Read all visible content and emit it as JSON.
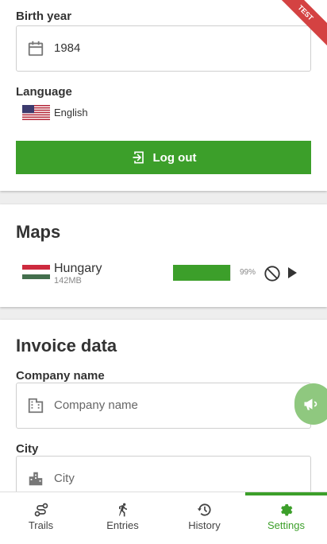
{
  "profile": {
    "birth_year_label": "Birth year",
    "birth_year_value": "1984",
    "language_label": "Language",
    "language_value": "English",
    "logout_label": "Log out"
  },
  "maps": {
    "title": "Maps",
    "items": [
      {
        "name": "Hungary",
        "size": "142MB",
        "progress_percent": 99,
        "progress_text": "99%"
      }
    ]
  },
  "invoice": {
    "title": "Invoice data",
    "company_label": "Company name",
    "company_placeholder": "Company name",
    "city_label": "City",
    "city_placeholder": "City"
  },
  "badge": {
    "text": "TEST"
  },
  "nav": {
    "items": [
      {
        "label": "Trails",
        "icon": "route-icon"
      },
      {
        "label": "Entries",
        "icon": "runner-icon"
      },
      {
        "label": "History",
        "icon": "history-icon"
      },
      {
        "label": "Settings",
        "icon": "gear-icon",
        "active": true
      }
    ]
  },
  "colors": {
    "accent": "#3c9f2a",
    "badge": "#d44242",
    "fab": "#8fc87f"
  }
}
